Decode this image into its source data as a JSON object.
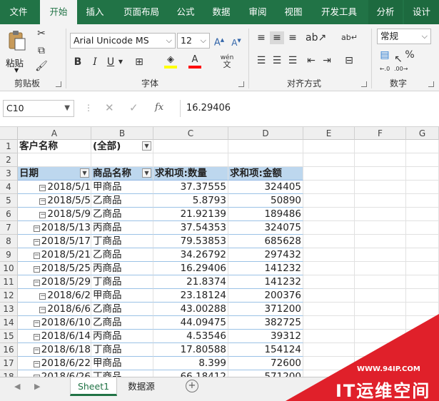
{
  "ribbon": {
    "tabs": [
      "文件",
      "开始",
      "插入",
      "页面布局",
      "公式",
      "数据",
      "审阅",
      "视图",
      "开发工具",
      "分析",
      "设计"
    ],
    "active_tab": "开始",
    "clipboard": {
      "paste_label": "粘贴",
      "group_label": "剪贴板"
    },
    "font": {
      "font_name": "Arial Unicode MS",
      "font_size": "12",
      "group_label": "字体",
      "bold": "B",
      "italic": "I",
      "underline": "U",
      "phonetic": "wén"
    },
    "alignment": {
      "group_label": "对齐方式"
    },
    "number": {
      "format": "常规",
      "percent": "%",
      "group_label": "数字"
    },
    "colors": {
      "brand": "#217346",
      "fill_highlight": "#ffff00",
      "font_color": "#ff0000"
    }
  },
  "formula_bar": {
    "name_box": "C10",
    "cancel": "✕",
    "enter": "✓",
    "fx": "fx",
    "value": "16.29406"
  },
  "grid": {
    "columns": [
      "A",
      "B",
      "C",
      "D",
      "E",
      "F",
      "G"
    ],
    "rows": [
      "1",
      "2",
      "3",
      "4",
      "5",
      "6",
      "7",
      "8",
      "9",
      "10",
      "11",
      "12",
      "13",
      "14",
      "15",
      "16",
      "17",
      "18"
    ],
    "filter": {
      "label": "客户名称",
      "value": "(全部)"
    },
    "headers": [
      "日期",
      "商品名称",
      "求和项:数量",
      "求和项:金额"
    ],
    "data": [
      [
        "2018/5/1",
        "甲商品",
        "37.37555",
        "324405"
      ],
      [
        "2018/5/5",
        "乙商品",
        "5.8793",
        "50890"
      ],
      [
        "2018/5/9",
        "乙商品",
        "21.92139",
        "189486"
      ],
      [
        "2018/5/13",
        "丙商品",
        "37.54353",
        "324075"
      ],
      [
        "2018/5/17",
        "丁商品",
        "79.53853",
        "685628"
      ],
      [
        "2018/5/21",
        "乙商品",
        "34.26792",
        "297432"
      ],
      [
        "2018/5/25",
        "丙商品",
        "16.29406",
        "141232"
      ],
      [
        "2018/5/29",
        "丁商品",
        "21.8374",
        "141232"
      ],
      [
        "2018/6/2",
        "甲商品",
        "23.18124",
        "200376"
      ],
      [
        "2018/6/6",
        "乙商品",
        "43.00288",
        "371200"
      ],
      [
        "2018/6/10",
        "乙商品",
        "44.09475",
        "382725"
      ],
      [
        "2018/6/14",
        "丙商品",
        "4.53546",
        "39312"
      ],
      [
        "2018/6/18",
        "丁商品",
        "17.80588",
        "154124"
      ],
      [
        "2018/6/22",
        "甲商品",
        "8.399",
        "72600"
      ],
      [
        "2018/6/26",
        "丁商品",
        "66.18412",
        "571200"
      ]
    ]
  },
  "sheets": {
    "tabs": [
      "Sheet1",
      "数据源"
    ],
    "active": "Sheet1"
  },
  "watermark": {
    "url": "WWW.94IP.COM",
    "brand": "IT运维空间"
  }
}
